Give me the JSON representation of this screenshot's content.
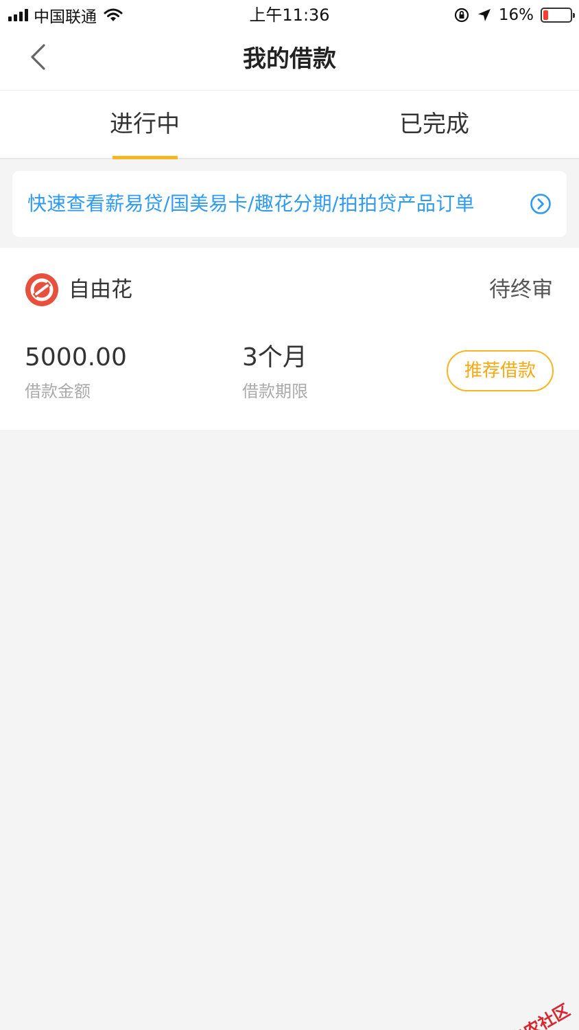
{
  "status_bar": {
    "carrier": "中国联通",
    "time": "上午11:36",
    "battery_percent": "16%",
    "icons": [
      "signal-icon",
      "wifi-icon",
      "rotation-lock-icon",
      "location-arrow-icon",
      "battery-icon"
    ]
  },
  "nav": {
    "title": "我的借款",
    "back_icon": "chevron-left-icon"
  },
  "tabs": [
    {
      "label": "进行中",
      "active": true
    },
    {
      "label": "已完成",
      "active": false
    }
  ],
  "banner": {
    "text": "快速查看薪易贷/国美易卡/趣花分期/拍拍贷产品订单",
    "icon": "circle-chevron-right-icon"
  },
  "loan": {
    "product_name": "自由花",
    "status": "待终审",
    "amount": "5000.00",
    "amount_label": "借款金额",
    "term": "3个月",
    "term_label": "借款期限",
    "action_label": "推荐借款"
  },
  "watermark": {
    "text": "卡农社区"
  },
  "colors": {
    "accent": "#f7b51f",
    "link": "#2f9af2",
    "logo": "#e8503e",
    "background": "#f4f4f4"
  }
}
